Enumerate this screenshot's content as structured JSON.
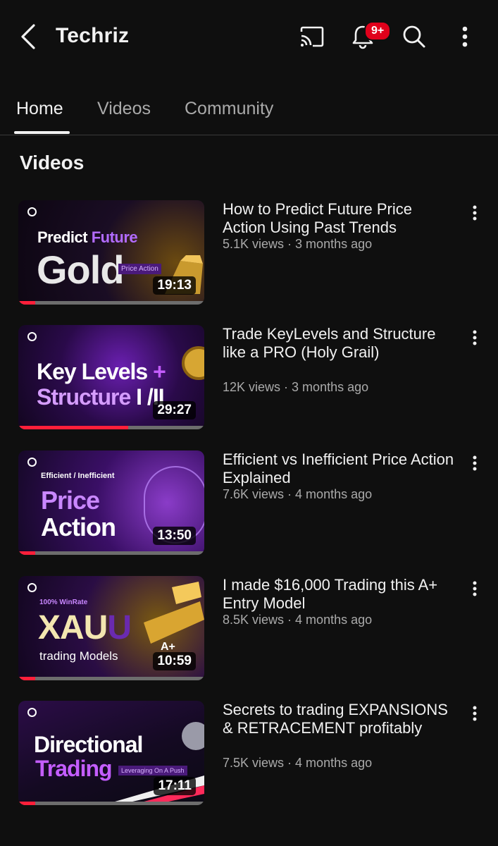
{
  "header": {
    "channel_name": "Techriz",
    "notification_badge": "9+",
    "icons": [
      "back-icon",
      "cast-icon",
      "bell-icon",
      "search-icon",
      "more-vert-icon"
    ]
  },
  "tabs": [
    {
      "label": "Home",
      "active": true
    },
    {
      "label": "Videos",
      "active": false
    },
    {
      "label": "Community",
      "active": false
    }
  ],
  "section": {
    "title": "Videos"
  },
  "videos": [
    {
      "title": "How to Predict Future Price Action Using Past Trends",
      "views": "5.1K views",
      "age": "3 months ago",
      "duration": "19:13",
      "watched_fraction": 0.09,
      "thumb_text": {
        "line1a": "Predict ",
        "line1b": "Future",
        "line2": "Gold",
        "tag": "Price Action"
      }
    },
    {
      "title": "Trade KeyLevels and Structure like a PRO (Holy Grail)",
      "views": "12K views",
      "age": "3 months ago",
      "duration": "29:27",
      "watched_fraction": 0.59,
      "thumb_text": {
        "line1a": "Key Levels ",
        "line1b": "+",
        "line2": "Structure",
        "line2b": " I /II"
      }
    },
    {
      "title": "Efficient vs Inefficient Price Action Explained",
      "views": "7.6K views",
      "age": "4 months ago",
      "duration": "13:50",
      "watched_fraction": 0.09,
      "thumb_text": {
        "small": "Efficient / Inefficient",
        "line1": "Price",
        "line2": "Action"
      }
    },
    {
      "title": "I made $16,000 Trading this A+ Entry Model",
      "views": "8.5K views",
      "age": "4 months ago",
      "duration": "10:59",
      "watched_fraction": 0.09,
      "thumb_text": {
        "small": "100% WinRate",
        "line1": "XAU",
        "line1b": "U",
        "line2": "trading Models",
        "tag": "A+"
      }
    },
    {
      "title": "Secrets to trading EXPANSIONS & RETRACEMENT profitably",
      "views": "7.5K views",
      "age": "4 months ago",
      "duration": "17:11",
      "watched_fraction": 0.09,
      "thumb_text": {
        "line1": "Directional",
        "line2": "Trading",
        "tag": "Leveraging On A Push"
      }
    }
  ],
  "colors": {
    "background": "#0f0f0f",
    "text_primary": "#f1f1f1",
    "text_secondary": "#aaaaaa",
    "badge_red": "#e0001b",
    "progress_red": "#ff1f3a",
    "thumb_purple": "#8a2be2"
  }
}
